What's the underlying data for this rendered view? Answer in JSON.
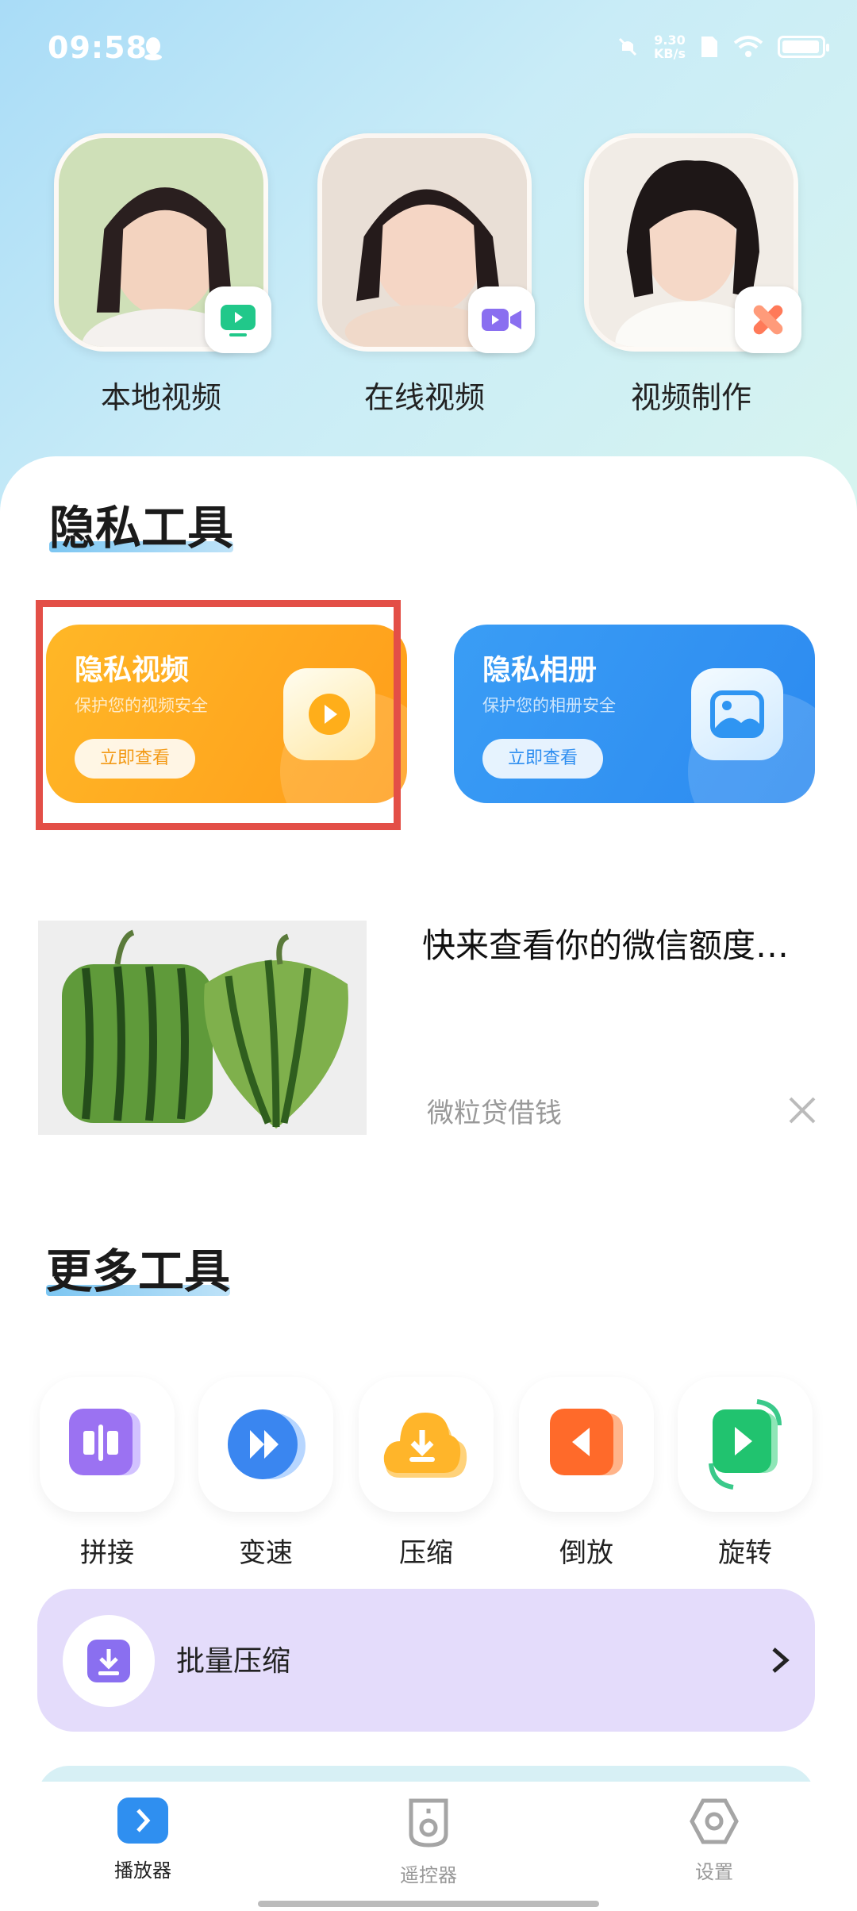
{
  "status_bar": {
    "time": "09:58",
    "net_speed_value": "9.30",
    "net_speed_unit": "KB/s"
  },
  "top_tiles": [
    {
      "label": "本地视频",
      "badge_icon": "tv-play-icon"
    },
    {
      "label": "在线视频",
      "badge_icon": "video-camera-icon"
    },
    {
      "label": "视频制作",
      "badge_icon": "scissors-icon"
    }
  ],
  "privacy_section": {
    "title": "隐私工具",
    "cards": [
      {
        "title": "隐私视频",
        "subtitle": "保护您的视频安全",
        "button": "立即查看",
        "color": "#ffae1f"
      },
      {
        "title": "隐私相册",
        "subtitle": "保护您的相册安全",
        "button": "立即查看",
        "color": "#2f95f2"
      }
    ]
  },
  "ad": {
    "title": "快来查看你的微信额度…",
    "source": "微粒贷借钱"
  },
  "more_tools": {
    "title": "更多工具",
    "items": [
      {
        "label": "拼接",
        "icon": "splice-icon"
      },
      {
        "label": "变速",
        "icon": "speed-icon"
      },
      {
        "label": "压缩",
        "icon": "compress-icon"
      },
      {
        "label": "倒放",
        "icon": "reverse-icon"
      },
      {
        "label": "旋转",
        "icon": "rotate-icon"
      }
    ],
    "batch": {
      "label": "批量压缩"
    }
  },
  "bottom_nav": [
    {
      "label": "播放器",
      "active": true
    },
    {
      "label": "遥控器",
      "active": false
    },
    {
      "label": "设置",
      "active": false
    }
  ]
}
